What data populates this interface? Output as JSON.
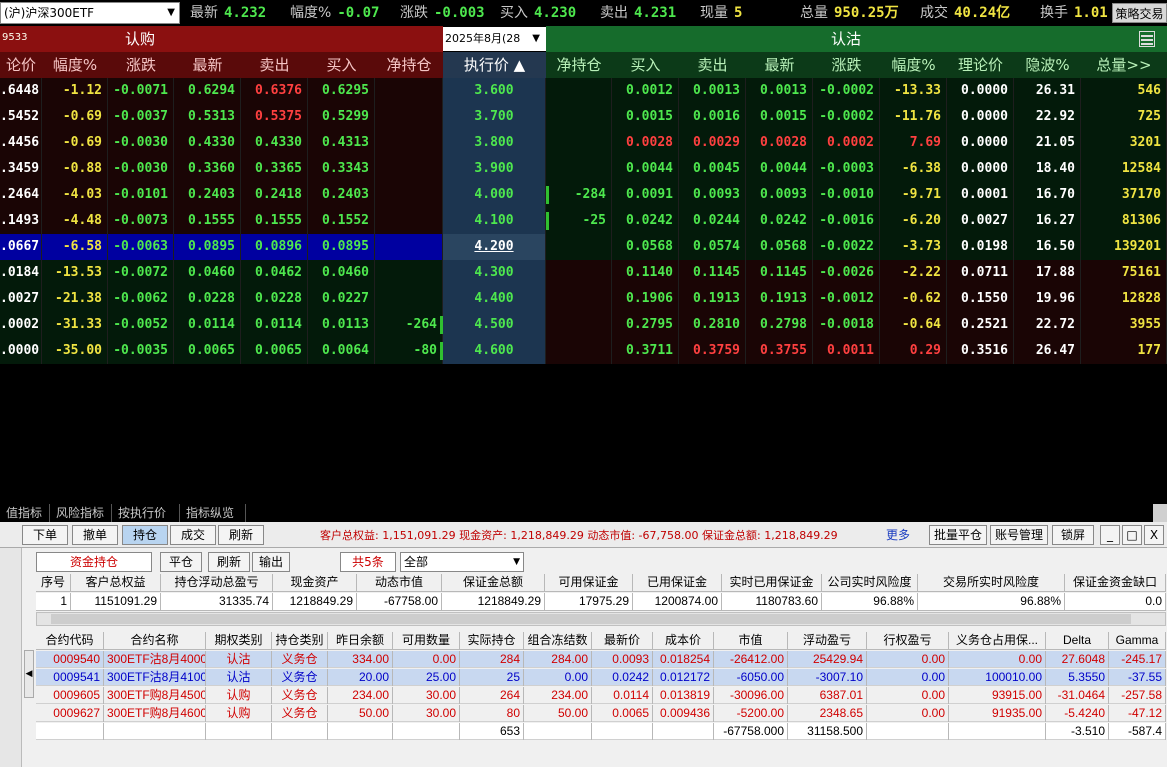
{
  "topbar": {
    "symbol": "(沪)沪深300ETF",
    "quotes": [
      {
        "label": "最新",
        "value": "4.232",
        "color": "g"
      },
      {
        "label": "幅度%",
        "value": "-0.07",
        "color": "g"
      },
      {
        "label": "涨跌",
        "value": "-0.003",
        "color": "g"
      },
      {
        "label": "买入",
        "value": "4.230",
        "color": "g"
      },
      {
        "label": "卖出",
        "value": "4.231",
        "color": "g"
      },
      {
        "label": "现量",
        "value": "5",
        "color": "y"
      },
      {
        "label": "总量",
        "value": "950.25万",
        "color": "y"
      },
      {
        "label": "成交",
        "value": "40.24亿",
        "color": "y"
      },
      {
        "label": "换手",
        "value": "1.01",
        "color": "y"
      }
    ],
    "strategy_button": "策略交易"
  },
  "chain": {
    "call_group_code": "9533",
    "call_group_label": "认购",
    "put_group_label": "认沽",
    "expiry": "2025年8月(28",
    "call_headers": [
      "论价",
      "幅度%",
      "涨跌",
      "最新",
      "卖出",
      "买入",
      "净持仓"
    ],
    "strike_header": "执行价 ▲",
    "put_headers": [
      "净持仓",
      "买入",
      "卖出",
      "最新",
      "涨跌",
      "幅度%",
      "理论价",
      "隐波%",
      "总量>>"
    ],
    "rows": [
      {
        "call": [
          ".6448",
          "-1.12",
          "-0.0071",
          "0.6294",
          "0.6376",
          "0.6295",
          ""
        ],
        "strike": "3.600",
        "put": [
          "",
          "0.0012",
          "0.0013",
          "0.0013",
          "-0.0002",
          "-13.33",
          "0.0000",
          "26.31",
          "546"
        ]
      },
      {
        "call": [
          ".5452",
          "-0.69",
          "-0.0037",
          "0.5313",
          "0.5375",
          "0.5299",
          ""
        ],
        "strike": "3.700",
        "put": [
          "",
          "0.0015",
          "0.0016",
          "0.0015",
          "-0.0002",
          "-11.76",
          "0.0000",
          "22.92",
          "725"
        ]
      },
      {
        "call": [
          ".4456",
          "-0.69",
          "-0.0030",
          "0.4330",
          "0.4330",
          "0.4313",
          ""
        ],
        "strike": "3.800",
        "put": [
          "",
          "0.0028",
          "0.0029",
          "0.0028",
          "0.0002",
          "7.69",
          "0.0000",
          "21.05",
          "3201"
        ]
      },
      {
        "call": [
          ".3459",
          "-0.88",
          "-0.0030",
          "0.3360",
          "0.3365",
          "0.3343",
          ""
        ],
        "strike": "3.900",
        "put": [
          "",
          "0.0044",
          "0.0045",
          "0.0044",
          "-0.0003",
          "-6.38",
          "0.0000",
          "18.40",
          "12584"
        ]
      },
      {
        "call": [
          ".2464",
          "-4.03",
          "-0.0101",
          "0.2403",
          "0.2418",
          "0.2403",
          ""
        ],
        "strike": "4.000",
        "put": [
          "-284",
          "0.0091",
          "0.0093",
          "0.0093",
          "-0.0010",
          "-9.71",
          "0.0001",
          "16.70",
          "37170"
        ]
      },
      {
        "call": [
          ".1493",
          "-4.48",
          "-0.0073",
          "0.1555",
          "0.1555",
          "0.1552",
          ""
        ],
        "strike": "4.100",
        "put": [
          "-25",
          "0.0242",
          "0.0244",
          "0.0242",
          "-0.0016",
          "-6.20",
          "0.0027",
          "16.27",
          "81306"
        ]
      },
      {
        "call": [
          ".0667",
          "-6.58",
          "-0.0063",
          "0.0895",
          "0.0896",
          "0.0895",
          ""
        ],
        "strike": "4.200",
        "put": [
          "",
          "0.0568",
          "0.0574",
          "0.0568",
          "-0.0022",
          "-3.73",
          "0.0198",
          "16.50",
          "139201"
        ]
      },
      {
        "call": [
          ".0184",
          "-13.53",
          "-0.0072",
          "0.0460",
          "0.0462",
          "0.0460",
          ""
        ],
        "strike": "4.300",
        "put": [
          "",
          "0.1140",
          "0.1145",
          "0.1145",
          "-0.0026",
          "-2.22",
          "0.0711",
          "17.88",
          "75161"
        ]
      },
      {
        "call": [
          ".0027",
          "-21.38",
          "-0.0062",
          "0.0228",
          "0.0228",
          "0.0227",
          ""
        ],
        "strike": "4.400",
        "put": [
          "",
          "0.1906",
          "0.1913",
          "0.1913",
          "-0.0012",
          "-0.62",
          "0.1550",
          "19.96",
          "12828"
        ]
      },
      {
        "call": [
          ".0002",
          "-31.33",
          "-0.0052",
          "0.0114",
          "0.0114",
          "0.0113",
          "-264"
        ],
        "strike": "4.500",
        "put": [
          "",
          "0.2795",
          "0.2810",
          "0.2798",
          "-0.0018",
          "-0.64",
          "0.2521",
          "22.72",
          "3955"
        ]
      },
      {
        "call": [
          ".0000",
          "-35.00",
          "-0.0035",
          "0.0065",
          "0.0065",
          "0.0064",
          "-80"
        ],
        "strike": "4.600",
        "put": [
          "",
          "0.3711",
          "0.3759",
          "0.3755",
          "0.0011",
          "0.29",
          "0.3516",
          "26.47",
          "177"
        ]
      }
    ]
  },
  "tabs": [
    "值指标",
    "风险指标",
    "按执行价",
    "指标纵览"
  ],
  "panel": {
    "toolbar": [
      "下单",
      "撤单",
      "持仓",
      "成交",
      "刷新"
    ],
    "summary": "客户总权益: 1,151,091.29  现金资产: 1,218,849.29  动态市值: -67,758.00  保证金总额: 1,218,849.29",
    "more": "更多",
    "right_buttons": [
      "批量平仓",
      "账号管理",
      "锁屏"
    ],
    "window_buttons": [
      "_",
      "□",
      "X"
    ],
    "filter_tab": "资金持仓",
    "sub_buttons": [
      "平仓",
      "刷新",
      "输出"
    ],
    "count": "共5条",
    "select_value": "全部",
    "account_headers": [
      "序号",
      "客户总权益",
      "持仓浮动总盈亏",
      "现金资产",
      "动态市值",
      "保证金总额",
      "可用保证金",
      "已用保证金",
      "实时已用保证金",
      "公司实时风险度",
      "交易所实时风险度",
      "保证金资金缺口"
    ],
    "account_row": [
      "1",
      "1151091.29",
      "31335.74",
      "1218849.29",
      "-67758.00",
      "1218849.29",
      "17975.29",
      "1200874.00",
      "1180783.60",
      "96.88%",
      "96.88%",
      "0.0"
    ],
    "position_headers": [
      "合约代码",
      "合约名称",
      "期权类别",
      "持仓类别",
      "昨日余额",
      "可用数量",
      "实际持仓",
      "组合冻结数",
      "最新价",
      "成本价",
      "市值",
      "浮动盈亏",
      "行权盈亏",
      "义务仓占用保...",
      "Delta",
      "Gamma"
    ],
    "positions": [
      {
        "cells": [
          "0009540",
          "300ETF沽8月4000",
          "认沽",
          "义务仓",
          "334.00",
          "0.00",
          "284",
          "284.00",
          "0.0093",
          "0.018254",
          "-26412.00",
          "25429.94",
          "0.00",
          "0.00",
          "27.6048",
          "-245.17"
        ],
        "color": "rc",
        "selected": true
      },
      {
        "cells": [
          "0009541",
          "300ETF沽8月4100",
          "认沽",
          "义务仓",
          "20.00",
          "25.00",
          "25",
          "0.00",
          "0.0242",
          "0.012172",
          "-6050.00",
          "-3007.10",
          "0.00",
          "100010.00",
          "5.3550",
          "-37.55"
        ],
        "color": "bc",
        "selected": true
      },
      {
        "cells": [
          "0009605",
          "300ETF购8月4500",
          "认购",
          "义务仓",
          "234.00",
          "30.00",
          "264",
          "234.00",
          "0.0114",
          "0.013819",
          "-30096.00",
          "6387.01",
          "0.00",
          "93915.00",
          "-31.0464",
          "-257.58"
        ],
        "color": "rc",
        "selected": false
      },
      {
        "cells": [
          "0009627",
          "300ETF购8月4600",
          "认购",
          "义务仓",
          "50.00",
          "30.00",
          "80",
          "50.00",
          "0.0065",
          "0.009436",
          "-5200.00",
          "2348.65",
          "0.00",
          "91935.00",
          "-5.4240",
          "-47.12"
        ],
        "color": "rc",
        "selected": false
      },
      {
        "cells": [
          "",
          "",
          "",
          "",
          "",
          "",
          "653",
          "",
          "",
          "",
          "-67758.000",
          "31158.500",
          "",
          "",
          "-3.510",
          "-587.4"
        ],
        "color": "tot",
        "selected": false
      }
    ]
  }
}
